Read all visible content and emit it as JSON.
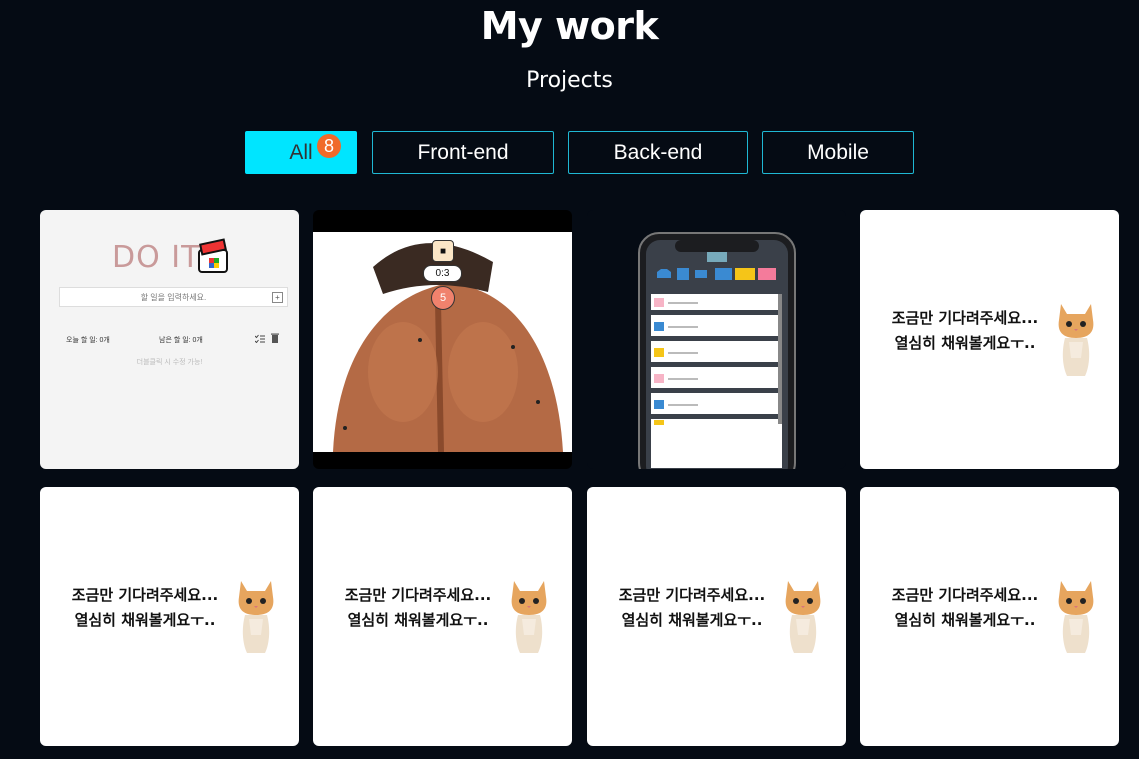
{
  "header": {
    "title": "My work",
    "subtitle": "Projects"
  },
  "filters": [
    {
      "label": "All",
      "badge": "8",
      "active": true
    },
    {
      "label": "Front-end"
    },
    {
      "label": "Back-end"
    },
    {
      "label": "Mobile"
    }
  ],
  "todo_card": {
    "title": "DO IT",
    "placeholder": "할 일을 입력하세요.",
    "plus": "+",
    "today_count": "오늘 할 일: 0개",
    "remaining_count": "남은 할 일: 0개",
    "hint": "더블클릭 시 수정 가능!"
  },
  "back_card": {
    "stop_icon": "■",
    "timer": "0:3",
    "count": "5"
  },
  "placeholder": {
    "line1": "조금만 기다려주세요...",
    "line2": "열심히 채워볼게요ㅜ.."
  },
  "colors": {
    "accent": "#00e5ff",
    "badge": "#f06a2a",
    "background": "#050b14"
  }
}
